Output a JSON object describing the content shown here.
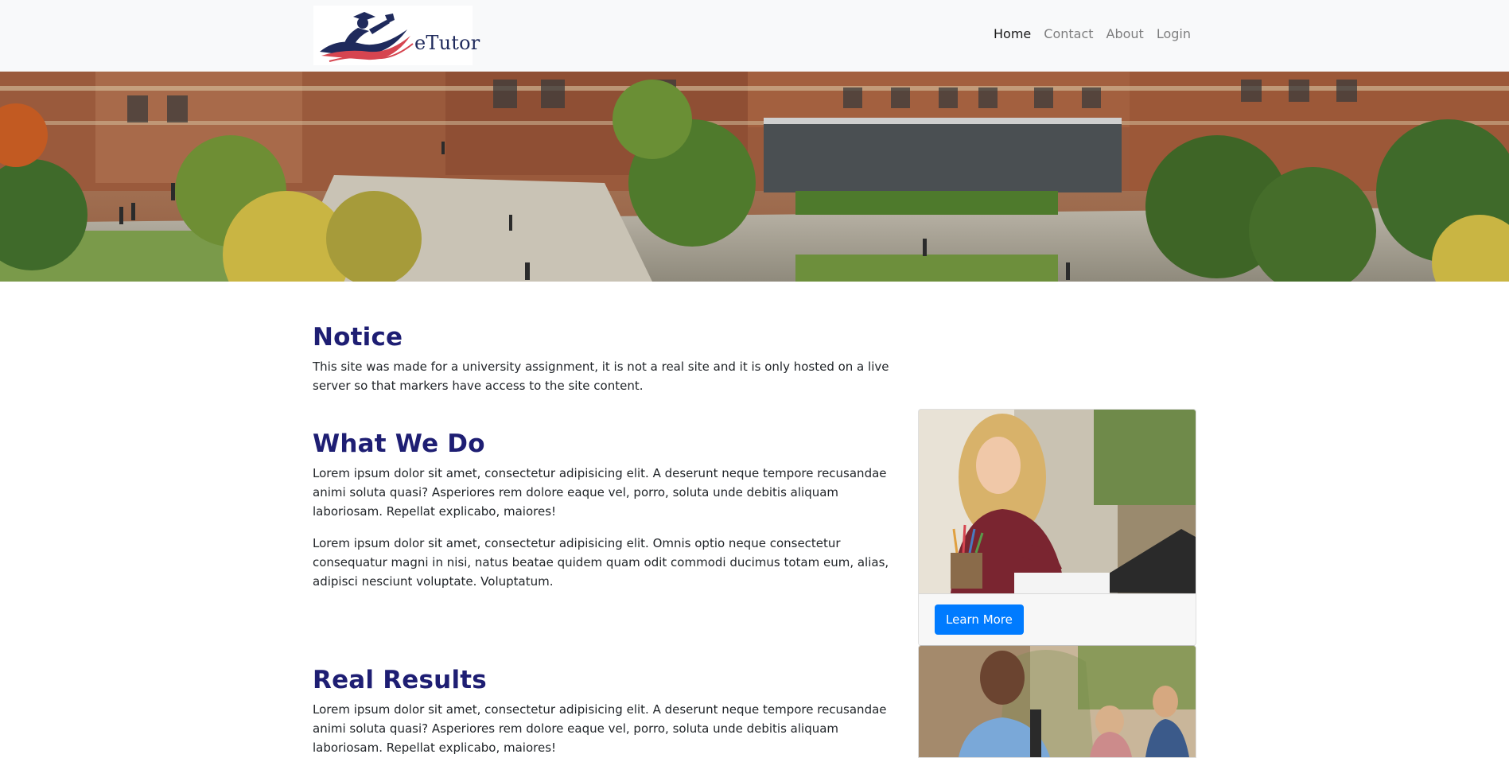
{
  "brand": {
    "name": "eTutor",
    "colors": {
      "navy": "#1f2a5c",
      "red": "#d64550",
      "heading": "#1e1e73",
      "primary": "#007bff"
    }
  },
  "nav": {
    "items": [
      {
        "label": "Home",
        "active": true
      },
      {
        "label": "Contact",
        "active": false
      },
      {
        "label": "About",
        "active": false
      },
      {
        "label": "Login",
        "active": false
      }
    ]
  },
  "hero": {
    "image": "university-campus-photo"
  },
  "notice": {
    "title": "Notice",
    "text": "This site was made for a university assignment, it is not a real site and it is only hosted on a live server so that markers have access to the site content."
  },
  "what_we_do": {
    "title": "What We Do",
    "p1": "Lorem ipsum dolor sit amet, consectetur adipisicing elit. A deserunt neque tempore recusandae animi soluta quasi? Asperiores rem dolore eaque vel, porro, soluta unde debitis aliquam laboriosam. Repellat explicabo, maiores!",
    "p2": "Lorem ipsum dolor sit amet, consectetur adipisicing elit. Omnis optio neque consectetur consequatur magni in nisi, natus beatae quidem quam odit commodi ducimus totam eum, alias, adipisci nesciunt voluptate. Voluptatum."
  },
  "real_results": {
    "title": "Real Results",
    "p1": "Lorem ipsum dolor sit amet, consectetur adipisicing elit. A deserunt neque tempore recusandae animi soluta quasi? Asperiores rem dolore eaque vel, porro, soluta unde debitis aliquam laboriosam. Repellat explicabo, maiores!"
  },
  "card": {
    "image": "student-studying-photo",
    "button_label": "Learn More"
  },
  "card2": {
    "image": "smiling-student-photo"
  }
}
